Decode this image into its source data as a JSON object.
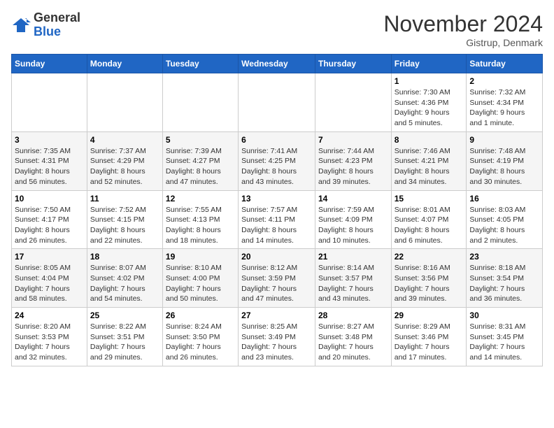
{
  "header": {
    "logo_general": "General",
    "logo_blue": "Blue",
    "month_title": "November 2024",
    "location": "Gistrup, Denmark"
  },
  "weekdays": [
    "Sunday",
    "Monday",
    "Tuesday",
    "Wednesday",
    "Thursday",
    "Friday",
    "Saturday"
  ],
  "weeks": [
    [
      {
        "day": "",
        "info": ""
      },
      {
        "day": "",
        "info": ""
      },
      {
        "day": "",
        "info": ""
      },
      {
        "day": "",
        "info": ""
      },
      {
        "day": "",
        "info": ""
      },
      {
        "day": "1",
        "info": "Sunrise: 7:30 AM\nSunset: 4:36 PM\nDaylight: 9 hours\nand 5 minutes."
      },
      {
        "day": "2",
        "info": "Sunrise: 7:32 AM\nSunset: 4:34 PM\nDaylight: 9 hours\nand 1 minute."
      }
    ],
    [
      {
        "day": "3",
        "info": "Sunrise: 7:35 AM\nSunset: 4:31 PM\nDaylight: 8 hours\nand 56 minutes."
      },
      {
        "day": "4",
        "info": "Sunrise: 7:37 AM\nSunset: 4:29 PM\nDaylight: 8 hours\nand 52 minutes."
      },
      {
        "day": "5",
        "info": "Sunrise: 7:39 AM\nSunset: 4:27 PM\nDaylight: 8 hours\nand 47 minutes."
      },
      {
        "day": "6",
        "info": "Sunrise: 7:41 AM\nSunset: 4:25 PM\nDaylight: 8 hours\nand 43 minutes."
      },
      {
        "day": "7",
        "info": "Sunrise: 7:44 AM\nSunset: 4:23 PM\nDaylight: 8 hours\nand 39 minutes."
      },
      {
        "day": "8",
        "info": "Sunrise: 7:46 AM\nSunset: 4:21 PM\nDaylight: 8 hours\nand 34 minutes."
      },
      {
        "day": "9",
        "info": "Sunrise: 7:48 AM\nSunset: 4:19 PM\nDaylight: 8 hours\nand 30 minutes."
      }
    ],
    [
      {
        "day": "10",
        "info": "Sunrise: 7:50 AM\nSunset: 4:17 PM\nDaylight: 8 hours\nand 26 minutes."
      },
      {
        "day": "11",
        "info": "Sunrise: 7:52 AM\nSunset: 4:15 PM\nDaylight: 8 hours\nand 22 minutes."
      },
      {
        "day": "12",
        "info": "Sunrise: 7:55 AM\nSunset: 4:13 PM\nDaylight: 8 hours\nand 18 minutes."
      },
      {
        "day": "13",
        "info": "Sunrise: 7:57 AM\nSunset: 4:11 PM\nDaylight: 8 hours\nand 14 minutes."
      },
      {
        "day": "14",
        "info": "Sunrise: 7:59 AM\nSunset: 4:09 PM\nDaylight: 8 hours\nand 10 minutes."
      },
      {
        "day": "15",
        "info": "Sunrise: 8:01 AM\nSunset: 4:07 PM\nDaylight: 8 hours\nand 6 minutes."
      },
      {
        "day": "16",
        "info": "Sunrise: 8:03 AM\nSunset: 4:05 PM\nDaylight: 8 hours\nand 2 minutes."
      }
    ],
    [
      {
        "day": "17",
        "info": "Sunrise: 8:05 AM\nSunset: 4:04 PM\nDaylight: 7 hours\nand 58 minutes."
      },
      {
        "day": "18",
        "info": "Sunrise: 8:07 AM\nSunset: 4:02 PM\nDaylight: 7 hours\nand 54 minutes."
      },
      {
        "day": "19",
        "info": "Sunrise: 8:10 AM\nSunset: 4:00 PM\nDaylight: 7 hours\nand 50 minutes."
      },
      {
        "day": "20",
        "info": "Sunrise: 8:12 AM\nSunset: 3:59 PM\nDaylight: 7 hours\nand 47 minutes."
      },
      {
        "day": "21",
        "info": "Sunrise: 8:14 AM\nSunset: 3:57 PM\nDaylight: 7 hours\nand 43 minutes."
      },
      {
        "day": "22",
        "info": "Sunrise: 8:16 AM\nSunset: 3:56 PM\nDaylight: 7 hours\nand 39 minutes."
      },
      {
        "day": "23",
        "info": "Sunrise: 8:18 AM\nSunset: 3:54 PM\nDaylight: 7 hours\nand 36 minutes."
      }
    ],
    [
      {
        "day": "24",
        "info": "Sunrise: 8:20 AM\nSunset: 3:53 PM\nDaylight: 7 hours\nand 32 minutes."
      },
      {
        "day": "25",
        "info": "Sunrise: 8:22 AM\nSunset: 3:51 PM\nDaylight: 7 hours\nand 29 minutes."
      },
      {
        "day": "26",
        "info": "Sunrise: 8:24 AM\nSunset: 3:50 PM\nDaylight: 7 hours\nand 26 minutes."
      },
      {
        "day": "27",
        "info": "Sunrise: 8:25 AM\nSunset: 3:49 PM\nDaylight: 7 hours\nand 23 minutes."
      },
      {
        "day": "28",
        "info": "Sunrise: 8:27 AM\nSunset: 3:48 PM\nDaylight: 7 hours\nand 20 minutes."
      },
      {
        "day": "29",
        "info": "Sunrise: 8:29 AM\nSunset: 3:46 PM\nDaylight: 7 hours\nand 17 minutes."
      },
      {
        "day": "30",
        "info": "Sunrise: 8:31 AM\nSunset: 3:45 PM\nDaylight: 7 hours\nand 14 minutes."
      }
    ]
  ]
}
